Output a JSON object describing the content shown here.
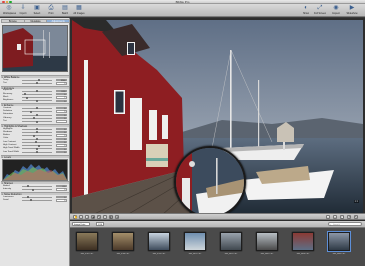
{
  "window": {
    "title": "Bibble Pro"
  },
  "toolbar": [
    {
      "label": "Workspaces",
      "icon": "workspaces-icon",
      "glyph": "◎"
    },
    {
      "label": "Import",
      "icon": "import-icon",
      "glyph": "⇩"
    },
    {
      "label": "Select",
      "icon": "select-icon",
      "glyph": "▣"
    },
    {
      "label": "Print",
      "icon": "print-icon",
      "glyph": "⎙"
    },
    {
      "label": "Batch",
      "icon": "batch-icon",
      "glyph": "▤"
    },
    {
      "label": "All Images",
      "icon": "all-images-icon",
      "glyph": "▦"
    }
  ],
  "toolbar_right": [
    {
      "label": "Show",
      "icon": "show-icon",
      "glyph": "◐"
    },
    {
      "label": "Full Screen",
      "icon": "fullscreen-icon",
      "glyph": "⤢"
    },
    {
      "label": "Inspect",
      "icon": "inspect-icon",
      "glyph": "◉"
    },
    {
      "label": "Slideshow",
      "icon": "slideshow-icon",
      "glyph": "▶"
    }
  ],
  "panel": {
    "tabs": [
      "Browse",
      "Metadata",
      "Adjustments"
    ],
    "active_tab": "Adjustments",
    "sections": [
      {
        "title": "White Balance",
        "rows": [
          {
            "label": "Temp",
            "value": "5500",
            "fraction": 0.55
          },
          {
            "label": "Tint",
            "value": "0",
            "fraction": 0.5
          }
        ]
      },
      {
        "title": "Exposure",
        "rows": [
          {
            "label": "Exposure",
            "value": "0.00",
            "fraction": 0.5
          },
          {
            "label": "Recovery",
            "value": "0",
            "fraction": 0.1
          },
          {
            "label": "Black",
            "value": "2",
            "fraction": 0.15
          },
          {
            "label": "Brightness",
            "value": "0",
            "fraction": 0.5
          }
        ]
      },
      {
        "title": "Enhance",
        "rows": [
          {
            "label": "Contrast",
            "value": "0",
            "fraction": 0.5
          },
          {
            "label": "Definition",
            "value": "0",
            "fraction": 0.3
          },
          {
            "label": "Saturation",
            "value": "0",
            "fraction": 0.5
          },
          {
            "label": "Vibrancy",
            "value": "0",
            "fraction": 0.4
          },
          {
            "label": "Tint",
            "value": "",
            "fraction": 0.5
          }
        ]
      },
      {
        "title": "Highlights & Shadows",
        "rows": [
          {
            "label": "Highlights",
            "value": "0",
            "fraction": 0.5
          },
          {
            "label": "Shadows",
            "value": "0",
            "fraction": 0.5
          },
          {
            "label": "Radius",
            "value": "0",
            "fraction": 0.4
          },
          {
            "label": "Color",
            "value": "0",
            "fraction": 0.5
          },
          {
            "label": "Low Contrast",
            "value": "0",
            "fraction": 0.45
          },
          {
            "label": "High Contrast",
            "value": "0",
            "fraction": 0.55
          },
          {
            "label": "High Tonal Width",
            "value": "0",
            "fraction": 0.5
          },
          {
            "label": "Low Tonal Width",
            "value": "0",
            "fraction": 0.5
          }
        ]
      },
      {
        "title": "Levels",
        "rows": []
      },
      {
        "title": "Sharpen",
        "rows": [
          {
            "label": "Radius",
            "value": "0.0",
            "fraction": 0.2
          },
          {
            "label": "Intensity",
            "value": "0",
            "fraction": 0.35
          }
        ]
      },
      {
        "title": "Noise Reduction",
        "rows": [
          {
            "label": "Luminance",
            "value": "0",
            "fraction": 0.2
          },
          {
            "label": "Detail",
            "value": "0",
            "fraction": 0.3
          }
        ]
      }
    ]
  },
  "viewer": {
    "badge": "1:1",
    "colors": {
      "sky_top": "#5f6f86",
      "sky_bottom": "#a9b2bf",
      "water": "#2c3a48",
      "house": "#8e1e22",
      "deck": "#5c5148"
    }
  },
  "image_tools": [
    {
      "icon": "hand-tool-icon",
      "glyph": "✋"
    },
    {
      "icon": "crop-tool-icon",
      "glyph": "⌗"
    },
    {
      "icon": "straighten-tool-icon",
      "glyph": "⊥"
    },
    {
      "icon": "redeye-tool-icon",
      "glyph": "◉"
    },
    {
      "icon": "retouch-tool-icon",
      "glyph": "✎"
    },
    {
      "icon": "brush-tool-icon",
      "glyph": "⌇"
    },
    {
      "icon": "compare-icon",
      "glyph": "◧"
    },
    {
      "icon": "loupe-icon",
      "glyph": "⊕"
    }
  ],
  "browser": {
    "sort_value": "Image Date",
    "count": "1/10",
    "search_placeholder": "Search",
    "thumbnails": [
      {
        "caption": "IMG_4781.CR2",
        "colors": [
          "#8a7a5a",
          "#3d2f22"
        ]
      },
      {
        "caption": "IMG_4788.CR2",
        "colors": [
          "#a48f6a",
          "#4b3a2a"
        ]
      },
      {
        "caption": "IMG_4793.CR2",
        "colors": [
          "#c7d3df",
          "#3e4b5b"
        ]
      },
      {
        "caption": "IMG_4812.CR2",
        "colors": [
          "#6f8fb0",
          "#cfd6db"
        ]
      },
      {
        "caption": "IMG_4822.CR2",
        "colors": [
          "#9aa3ad",
          "#40484f"
        ]
      },
      {
        "caption": "IMG_4841.CR2",
        "colors": [
          "#b7bec4",
          "#4a4a4a"
        ]
      },
      {
        "caption": "IMG_4856.CR2",
        "colors": [
          "#8b3a34",
          "#5d6f86"
        ]
      },
      {
        "caption": "IMG_4863.CR2",
        "colors": [
          "#8b96a6",
          "#2f3a46"
        ]
      }
    ],
    "selected_index": 7
  }
}
